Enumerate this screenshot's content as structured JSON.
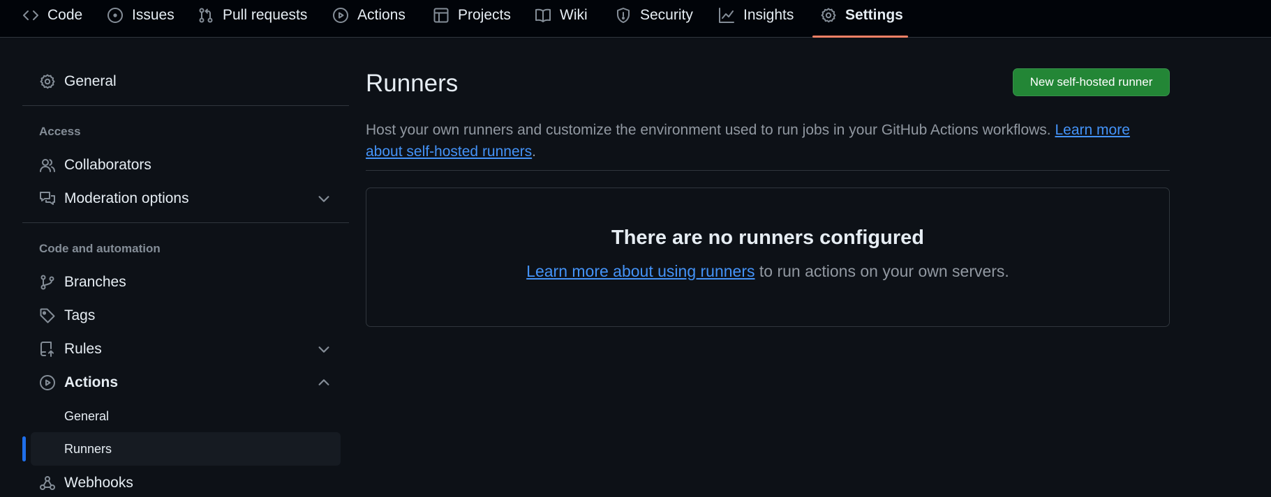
{
  "repo_nav": {
    "tabs": [
      {
        "label": "Code",
        "icon": "code-icon"
      },
      {
        "label": "Issues",
        "icon": "issue-opened-icon"
      },
      {
        "label": "Pull requests",
        "icon": "git-pull-request-icon"
      },
      {
        "label": "Actions",
        "icon": "play-icon"
      },
      {
        "label": "Projects",
        "icon": "table-icon"
      },
      {
        "label": "Wiki",
        "icon": "book-icon"
      },
      {
        "label": "Security",
        "icon": "shield-icon"
      },
      {
        "label": "Insights",
        "icon": "graph-icon"
      },
      {
        "label": "Settings",
        "icon": "gear-icon",
        "selected": true
      }
    ]
  },
  "sidebar": {
    "general": {
      "label": "General",
      "icon": "gear-icon"
    },
    "sections": [
      {
        "heading": "Access",
        "items": [
          {
            "label": "Collaborators",
            "icon": "people-icon"
          },
          {
            "label": "Moderation options",
            "icon": "comment-discussion-icon",
            "expandable": true,
            "expanded": false
          }
        ]
      },
      {
        "heading": "Code and automation",
        "items": [
          {
            "label": "Branches",
            "icon": "git-branch-icon"
          },
          {
            "label": "Tags",
            "icon": "tag-icon"
          },
          {
            "label": "Rules",
            "icon": "repo-push-icon",
            "expandable": true,
            "expanded": false
          },
          {
            "label": "Actions",
            "icon": "play-icon",
            "expandable": true,
            "expanded": true,
            "children": [
              {
                "label": "General"
              },
              {
                "label": "Runners",
                "selected": true
              }
            ]
          },
          {
            "label": "Webhooks",
            "icon": "webhook-icon"
          }
        ]
      }
    ]
  },
  "main": {
    "title": "Runners",
    "new_runner_button": "New self-hosted runner",
    "description": {
      "text": "Host your own runners and customize the environment used to run jobs in your GitHub Actions workflows.",
      "link_line1": "Learn more",
      "link_line2": "about self-hosted runners",
      "trailing": "."
    },
    "blankslate": {
      "title": "There are no runners configured",
      "link": "Learn more about using runners",
      "text": "to run actions on your own servers."
    }
  },
  "colors": {
    "background": "#0d1117",
    "header_background": "#010409",
    "border": "#30363d",
    "text": "#e6edf3",
    "muted_text": "#9198a1",
    "icon": "#848d97",
    "link": "#4493f8",
    "primary_button": "#238636",
    "selected_tab_underline": "#f78166",
    "selected_nav_marker": "#1f6feb"
  }
}
